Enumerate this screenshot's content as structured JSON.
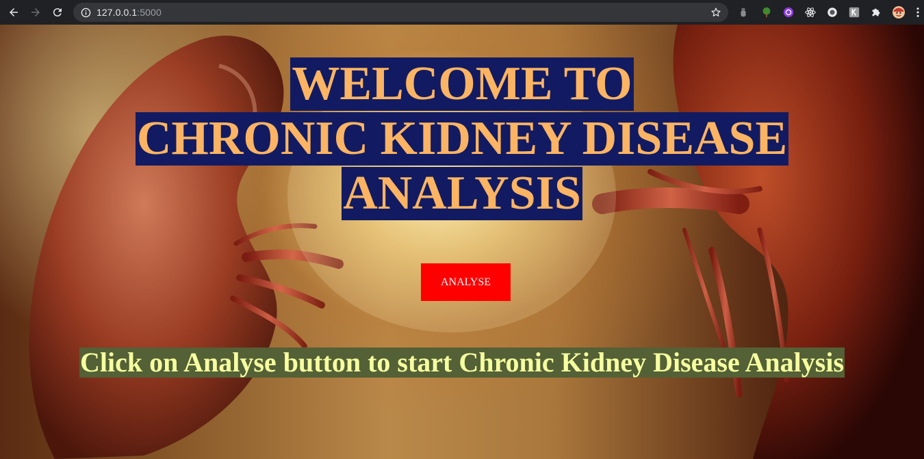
{
  "browser": {
    "url_host": "127.0.0.1",
    "url_port": ":5000",
    "toolbar_icons": [
      "back-icon",
      "forward-icon",
      "reload-icon",
      "site-info-icon",
      "bookmark-star-icon"
    ],
    "extensions": [
      "lamp-icon",
      "tree-icon",
      "purple-circle-icon",
      "react-atom-icon",
      "record-circle-icon",
      "k-box-icon",
      "puzzle-icon",
      "avatar"
    ]
  },
  "page": {
    "title_lines": [
      "WELCOME TO",
      "CHRONIC KIDNEY DISEASE",
      "ANALYSIS"
    ],
    "analyse_button": "ANALYSE",
    "instruction": "Click on Analyse button to start Chronic Kidney Disease Analysis"
  },
  "colors": {
    "title_text": "#fbb463",
    "title_bg": "#121b62",
    "button_bg": "#ff0000",
    "button_text": "#ffffff",
    "instruction_text": "#f6ffa0",
    "instruction_bg": "#546035"
  }
}
